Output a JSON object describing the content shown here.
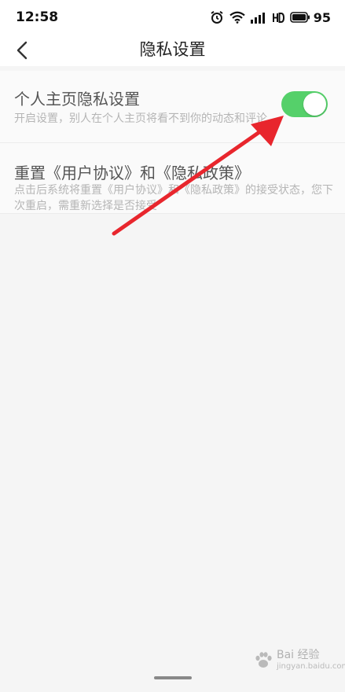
{
  "status_bar": {
    "time": "12:58",
    "battery_level": "95",
    "icons": [
      "alarm-icon",
      "wifi-icon",
      "signal-icon",
      "hd-icon",
      "battery-icon"
    ]
  },
  "header": {
    "title": "隐私设置",
    "back_icon": "chevron-left-icon"
  },
  "settings": {
    "items": [
      {
        "title": "个人主页隐私设置",
        "description": "开启设置，别人在个人主页将看不到你的动态和评论",
        "toggle_on": true
      },
      {
        "title": "重置《用户协议》和《隐私政策》",
        "description": "点击后系统将重置《用户协议》和《隐私政策》的接受状态，您下次重启，需重新选择是否接受"
      }
    ]
  },
  "colors": {
    "toggle_on": "#55d06a",
    "annotation_arrow": "#e8262d"
  },
  "watermark": {
    "brand": "Bai 经验",
    "site": "jingyan.baidu.com"
  }
}
